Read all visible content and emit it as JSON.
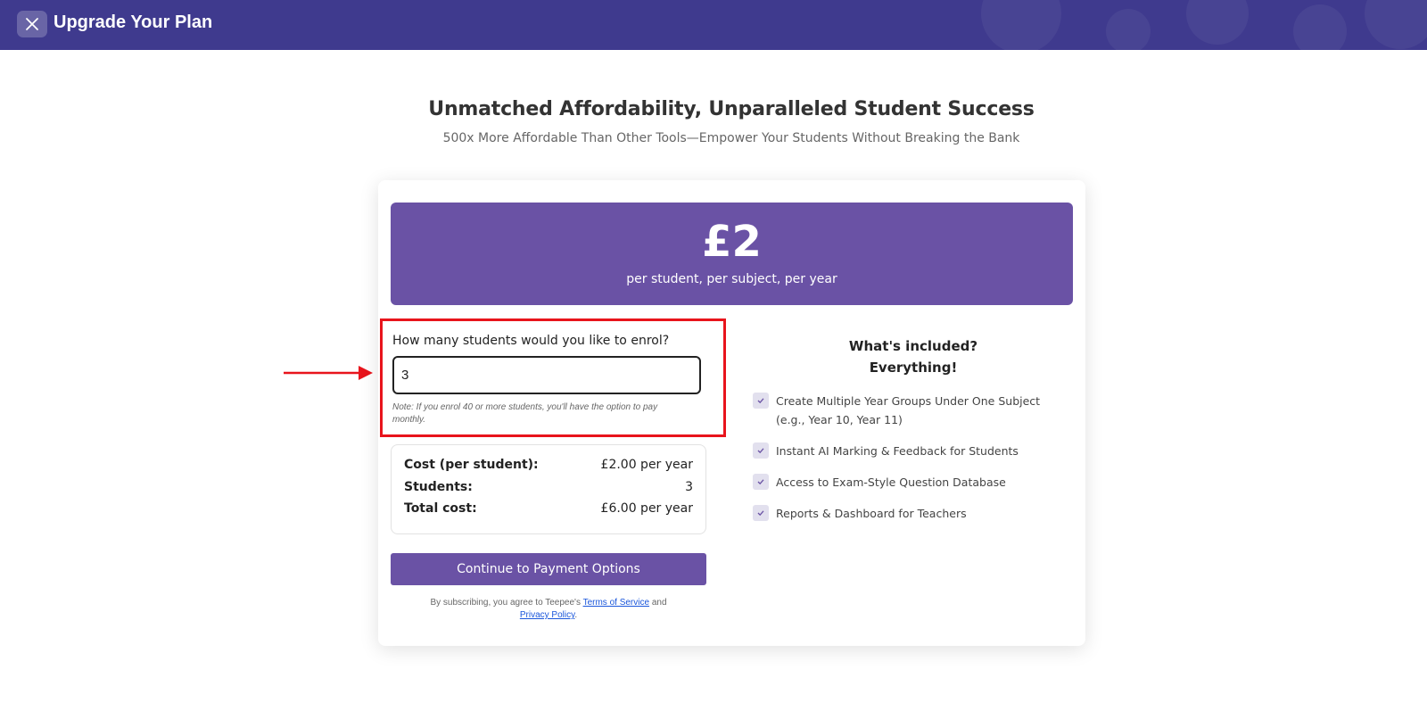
{
  "header": {
    "title": "Upgrade Your Plan",
    "close_icon": "close-icon",
    "background": "#3f3a8e"
  },
  "hero": {
    "title": "Unmatched Affordability, Unparalleled Student Success",
    "subtitle": "500x More Affordable Than Other Tools—Empower Your Students Without Breaking the Bank"
  },
  "pricing": {
    "amount": "£2",
    "caption": "per student, per subject, per year",
    "accent": "#6a52a5"
  },
  "enrol": {
    "label": "How many students would you like to enrol?",
    "value": "3",
    "note": "Note: If you enrol 40 or more students, you'll have the option to pay monthly.",
    "highlight_color": "#e8141c"
  },
  "summary": {
    "rows": [
      {
        "label": "Cost (per student):",
        "value": "£2.00 per year"
      },
      {
        "label": "Students:",
        "value": "3"
      },
      {
        "label": "Total cost:",
        "value": "£6.00 per year"
      }
    ]
  },
  "actions": {
    "continue_label": "Continue to Payment Options"
  },
  "terms": {
    "prefix": "By subscribing, you agree to Teepee's",
    "tos_label": "Terms of Service",
    "and": "and",
    "privacy_label": "Privacy Policy",
    "suffix": "."
  },
  "included": {
    "heading_line1": "What's included?",
    "heading_line2": "Everything!",
    "features": [
      "Create Multiple Year Groups Under One Subject (e.g., Year 10, Year 11)",
      "Instant AI Marking & Feedback for Students",
      "Access to Exam-Style Question Database",
      "Reports & Dashboard for Teachers"
    ],
    "check_icon": "check-icon"
  },
  "annotation": {
    "arrow_icon": "arrow-right-icon",
    "color": "#e8141c"
  }
}
